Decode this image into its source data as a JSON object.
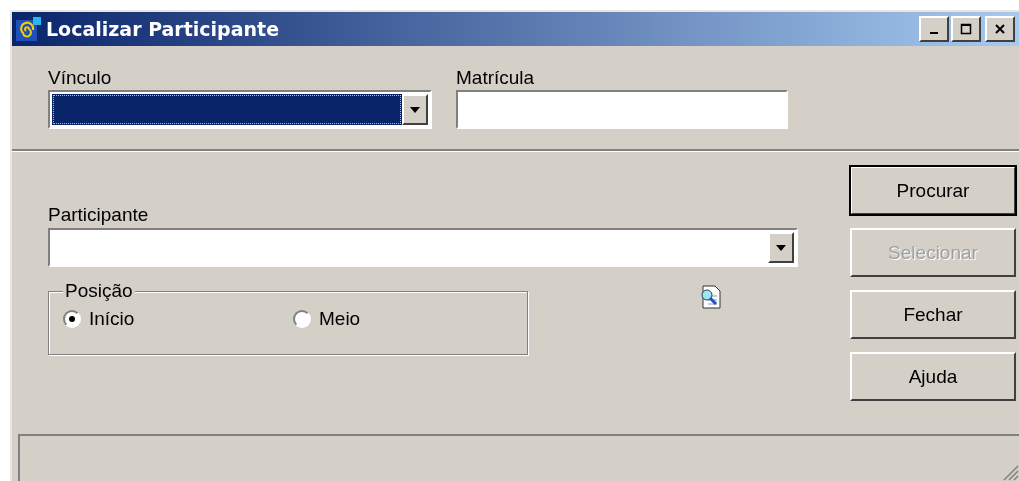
{
  "window": {
    "title": "Localizar Participante"
  },
  "top_fields": [
    {
      "label": "Vínculo",
      "kind": "dropdown",
      "focused": true
    },
    {
      "label": "Matrícula",
      "kind": "text",
      "focused": false
    }
  ],
  "participant_field": {
    "label": "Participante",
    "kind": "dropdown"
  },
  "position_group": {
    "label": "Posição",
    "options": [
      {
        "label": "Início",
        "selected": true
      },
      {
        "label": "Meio",
        "selected": false
      }
    ]
  },
  "buttons": [
    {
      "label": "Procurar",
      "default": true,
      "disabled": false
    },
    {
      "label": "Selecionar",
      "default": false,
      "disabled": true
    },
    {
      "label": "Fechar",
      "default": false,
      "disabled": false
    },
    {
      "label": "Ajuda",
      "default": false,
      "disabled": false
    }
  ]
}
